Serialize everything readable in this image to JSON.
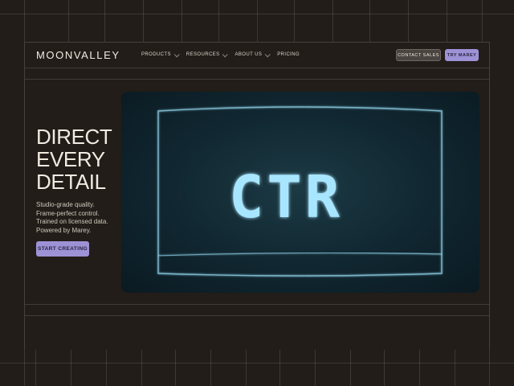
{
  "brand": {
    "logo": "MOONVALLEY",
    "accent": "#9d92d6",
    "background": "#221d19"
  },
  "nav": {
    "items": [
      {
        "label": "PRODUCTS",
        "has_dropdown": true
      },
      {
        "label": "RESOURCES",
        "has_dropdown": true
      },
      {
        "label": "ABOUT US",
        "has_dropdown": true
      },
      {
        "label": "PRICING",
        "has_dropdown": false
      }
    ],
    "contact_label": "CONTACT SALES",
    "try_label": "TRY MAREY"
  },
  "hero": {
    "title_lines": [
      "DIRECT",
      "EVERY",
      "DETAIL"
    ],
    "description_lines": [
      "Studio-grade quality.",
      "Frame-perfect control.",
      "Trained on licensed data.",
      "Powered by Marey."
    ],
    "cta_label": "START CREATING"
  },
  "video": {
    "screen_text": "CTR",
    "glow_color": "#a8e6ff"
  }
}
